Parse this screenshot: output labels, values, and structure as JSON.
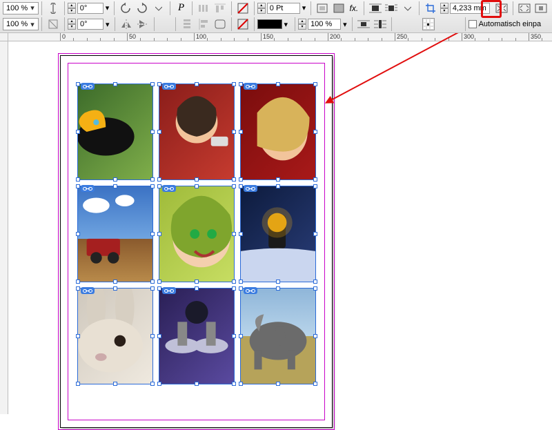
{
  "toolbar": {
    "zoom1": "100 %",
    "zoom2": "100 %",
    "rotate1": "0°",
    "rotate2": "0°",
    "stroke_pt": "0 Pt",
    "scale_pct": "100 %",
    "gap_value": "4,233 mm",
    "fit_label": "Automatisch einpa"
  },
  "ruler": {
    "ticks": [
      "0",
      "50",
      "100",
      "150",
      "200",
      "250",
      "300",
      "350"
    ]
  },
  "images": [
    {
      "alt": "Toucan on branch"
    },
    {
      "alt": "Woman with car keys"
    },
    {
      "alt": "Blonde woman portrait"
    },
    {
      "alt": "Tractor in field"
    },
    {
      "alt": "Baby in green hood"
    },
    {
      "alt": "Lantern in snow"
    },
    {
      "alt": "Rabbit close-up"
    },
    {
      "alt": "Drum kit on stage"
    },
    {
      "alt": "Elephant on savanna"
    }
  ],
  "highlight": {
    "target": "fit-frame-to-content-button"
  }
}
